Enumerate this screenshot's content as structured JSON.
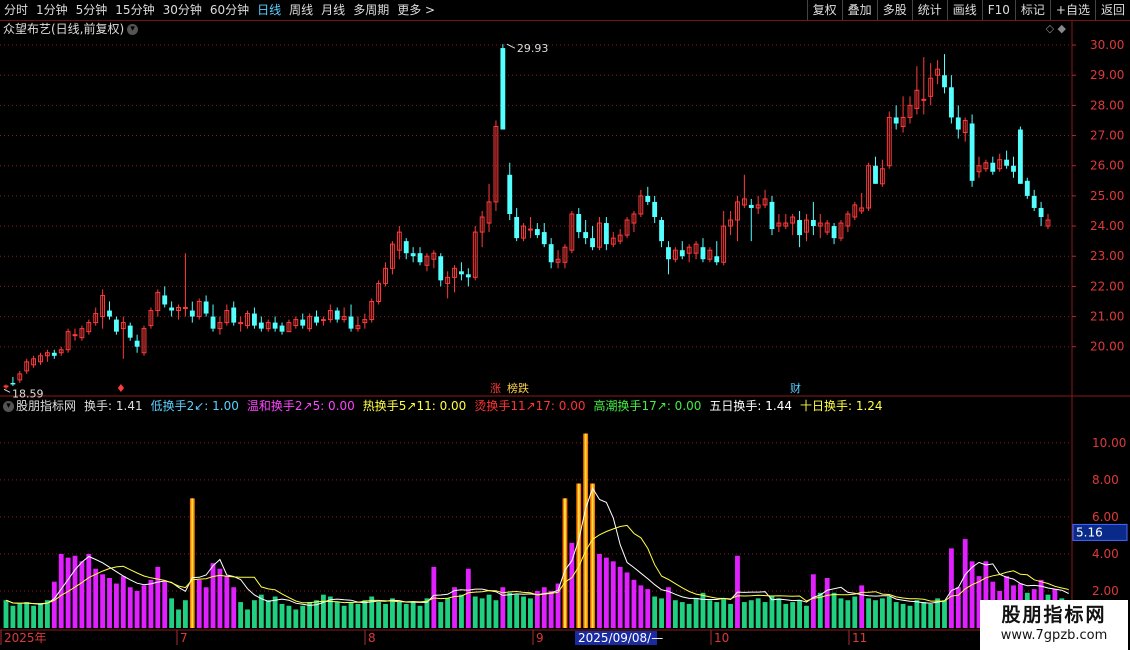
{
  "toolbar": {
    "periods": [
      "分时",
      "1分钟",
      "5分钟",
      "15分钟",
      "30分钟",
      "60分钟",
      "日线",
      "周线",
      "月线",
      "多周期",
      "更多 >"
    ],
    "active": "日线",
    "right_buttons": [
      "复权",
      "叠加",
      "多股",
      "统计",
      "画线",
      "F10",
      "标记",
      "+自选",
      "返回"
    ]
  },
  "price_panel": {
    "title": "众望布艺(日线,前复权)",
    "y_ticks": [
      "30.00",
      "29.00",
      "28.00",
      "27.00",
      "26.00",
      "25.00",
      "24.00",
      "23.00",
      "22.00",
      "21.00",
      "20.00"
    ],
    "high_label": "29.93",
    "low_label": "18.59",
    "markers": [
      "涨",
      "榜跌",
      "财"
    ],
    "top_icons": "◇ ◆"
  },
  "indicator_panel": {
    "name": "股朋指标网",
    "items": [
      {
        "label": "换手: 1.41",
        "color": "#dddddd"
      },
      {
        "label": "低换手2↙: 1.00",
        "color": "#5ad0ff"
      },
      {
        "label": "温和换手2↗5: 0.00",
        "color": "#ff44ff"
      },
      {
        "label": "热换手5↗11: 0.00",
        "color": "#ffff44"
      },
      {
        "label": "烫换手11↗17: 0.00",
        "color": "#ff3333"
      },
      {
        "label": "高潮换手17↗: 0.00",
        "color": "#44ee44"
      },
      {
        "label": "五日换手: 1.44",
        "color": "#ffffff"
      },
      {
        "label": "十日换手: 1.24",
        "color": "#ffff44"
      }
    ],
    "y_ticks": [
      "10.00",
      "8.00",
      "6.00",
      "4.00",
      "2.00"
    ],
    "current_value": "5.16"
  },
  "date_axis": {
    "labels": [
      "2025年",
      "7",
      "8",
      "9",
      "10",
      "11"
    ],
    "cursor_date": "2025/09/08/—"
  },
  "watermark": {
    "line1": "股朋指标网",
    "line2": "www.7gpzb.com"
  },
  "colors": {
    "up": "#ff3b3b",
    "down": "#54ffff",
    "grid": "#8b1a1a",
    "turnover_green": "#20d080",
    "turnover_magenta": "#e020ff",
    "turnover_gold": "#ffc000"
  },
  "chart_data": {
    "type": "candlestick",
    "ylim": [
      18.4,
      30.3
    ],
    "candles": [
      [
        18.7,
        18.75,
        18.59,
        18.7
      ],
      [
        18.8,
        19.0,
        18.7,
        18.75
      ],
      [
        18.9,
        19.2,
        18.8,
        19.1
      ],
      [
        19.2,
        19.6,
        19.1,
        19.5
      ],
      [
        19.4,
        19.7,
        19.3,
        19.6
      ],
      [
        19.5,
        19.8,
        19.4,
        19.7
      ],
      [
        19.7,
        19.9,
        19.5,
        19.8
      ],
      [
        19.8,
        19.9,
        19.6,
        19.7
      ],
      [
        19.8,
        20.0,
        19.7,
        19.9
      ],
      [
        19.9,
        20.6,
        19.8,
        20.5
      ],
      [
        20.4,
        20.6,
        20.2,
        20.4
      ],
      [
        20.3,
        20.7,
        20.2,
        20.6
      ],
      [
        20.5,
        20.9,
        20.4,
        20.8
      ],
      [
        20.8,
        21.3,
        20.7,
        21.1
      ],
      [
        21.0,
        21.9,
        20.6,
        21.7
      ],
      [
        21.2,
        21.5,
        20.9,
        21.0
      ],
      [
        20.9,
        21.0,
        20.4,
        20.5
      ],
      [
        20.6,
        21.0,
        19.6,
        20.8
      ],
      [
        20.7,
        20.8,
        20.2,
        20.3
      ],
      [
        20.2,
        20.4,
        19.8,
        20.0
      ],
      [
        19.8,
        20.7,
        19.7,
        20.6
      ],
      [
        20.7,
        21.3,
        20.6,
        21.2
      ],
      [
        21.2,
        21.9,
        21.0,
        21.8
      ],
      [
        21.7,
        22.0,
        21.3,
        21.4
      ],
      [
        21.3,
        21.5,
        21.0,
        21.2
      ],
      [
        21.2,
        21.4,
        20.9,
        21.3
      ],
      [
        21.3,
        23.1,
        21.0,
        21.3
      ],
      [
        21.2,
        21.5,
        20.8,
        21.0
      ],
      [
        21.0,
        21.6,
        20.9,
        21.5
      ],
      [
        21.5,
        21.7,
        21.0,
        21.1
      ],
      [
        21.0,
        21.4,
        20.5,
        20.6
      ],
      [
        20.6,
        21.0,
        20.4,
        20.8
      ],
      [
        20.8,
        21.4,
        20.7,
        21.2
      ],
      [
        21.3,
        21.5,
        20.7,
        20.8
      ],
      [
        20.8,
        21.0,
        20.5,
        20.8
      ],
      [
        20.7,
        21.2,
        20.6,
        21.1
      ],
      [
        21.1,
        21.3,
        20.6,
        20.7
      ],
      [
        20.8,
        21.0,
        20.5,
        20.6
      ],
      [
        20.6,
        20.9,
        20.5,
        20.8
      ],
      [
        20.8,
        21.0,
        20.5,
        20.6
      ],
      [
        20.7,
        20.8,
        20.4,
        20.5
      ],
      [
        20.5,
        20.9,
        20.5,
        20.8
      ],
      [
        20.7,
        21.0,
        20.6,
        20.9
      ],
      [
        20.9,
        21.1,
        20.6,
        20.7
      ],
      [
        20.6,
        21.1,
        20.5,
        21.0
      ],
      [
        21.0,
        21.2,
        20.7,
        20.8
      ],
      [
        20.9,
        21.0,
        20.7,
        20.9
      ],
      [
        20.9,
        21.4,
        20.8,
        21.2
      ],
      [
        21.2,
        21.3,
        20.8,
        20.9
      ],
      [
        20.9,
        21.3,
        20.8,
        21.0
      ],
      [
        21.0,
        21.4,
        20.5,
        20.6
      ],
      [
        20.6,
        21.0,
        20.5,
        20.7
      ],
      [
        20.8,
        21.1,
        20.6,
        20.9
      ],
      [
        20.9,
        21.6,
        20.8,
        21.5
      ],
      [
        21.5,
        22.2,
        21.4,
        22.1
      ],
      [
        22.1,
        22.8,
        22.0,
        22.6
      ],
      [
        22.6,
        23.5,
        22.4,
        23.4
      ],
      [
        23.2,
        24.0,
        22.9,
        23.8
      ],
      [
        23.5,
        23.6,
        22.9,
        23.1
      ],
      [
        23.1,
        23.3,
        22.8,
        23.0
      ],
      [
        23.1,
        23.3,
        22.7,
        22.8
      ],
      [
        22.7,
        23.1,
        22.5,
        23.0
      ],
      [
        22.9,
        23.2,
        22.6,
        23.1
      ],
      [
        23.0,
        23.1,
        22.0,
        22.2
      ],
      [
        22.1,
        22.5,
        21.6,
        22.3
      ],
      [
        22.3,
        22.7,
        21.8,
        22.6
      ],
      [
        22.5,
        22.8,
        22.2,
        22.4
      ],
      [
        22.4,
        22.6,
        22.0,
        22.3
      ],
      [
        22.3,
        24.0,
        22.2,
        23.8
      ],
      [
        23.8,
        24.5,
        23.3,
        24.3
      ],
      [
        24.1,
        25.4,
        23.8,
        24.8
      ],
      [
        24.8,
        27.5,
        24.5,
        27.3
      ],
      [
        29.9,
        30.03,
        27.3,
        27.2
      ],
      [
        25.7,
        26.1,
        24.2,
        24.4
      ],
      [
        24.3,
        24.6,
        23.5,
        23.6
      ],
      [
        23.6,
        24.1,
        23.5,
        24.0
      ],
      [
        23.9,
        24.3,
        23.6,
        23.9
      ],
      [
        23.9,
        24.1,
        23.6,
        23.7
      ],
      [
        23.8,
        24.1,
        23.3,
        23.4
      ],
      [
        23.4,
        23.6,
        22.6,
        22.8
      ],
      [
        22.8,
        23.2,
        22.6,
        22.9
      ],
      [
        22.8,
        23.4,
        22.6,
        23.3
      ],
      [
        23.2,
        24.5,
        23.1,
        24.4
      ],
      [
        24.4,
        24.6,
        23.6,
        23.8
      ],
      [
        23.8,
        24.2,
        23.4,
        23.6
      ],
      [
        23.6,
        24.0,
        23.2,
        23.3
      ],
      [
        23.3,
        24.3,
        23.2,
        24.1
      ],
      [
        24.1,
        24.3,
        23.2,
        23.4
      ],
      [
        23.4,
        23.8,
        23.3,
        23.6
      ],
      [
        23.5,
        23.9,
        23.4,
        23.7
      ],
      [
        23.7,
        24.3,
        23.6,
        24.2
      ],
      [
        24.1,
        24.5,
        23.8,
        24.4
      ],
      [
        24.4,
        25.2,
        24.3,
        25.0
      ],
      [
        25.0,
        25.3,
        24.7,
        24.8
      ],
      [
        24.8,
        25.0,
        24.1,
        24.3
      ],
      [
        24.2,
        24.3,
        23.3,
        23.5
      ],
      [
        23.3,
        23.5,
        22.4,
        22.9
      ],
      [
        22.9,
        23.3,
        22.8,
        23.2
      ],
      [
        23.2,
        23.5,
        22.9,
        23.0
      ],
      [
        23.1,
        23.4,
        22.8,
        23.3
      ],
      [
        23.1,
        23.5,
        22.9,
        23.4
      ],
      [
        23.3,
        23.6,
        22.8,
        22.9
      ],
      [
        22.9,
        23.3,
        22.8,
        23.2
      ],
      [
        23.0,
        23.5,
        22.7,
        22.8
      ],
      [
        22.8,
        24.5,
        22.7,
        24.0
      ],
      [
        24.0,
        24.5,
        23.7,
        24.2
      ],
      [
        24.2,
        25.0,
        23.5,
        24.8
      ],
      [
        24.7,
        25.7,
        24.6,
        24.9
      ],
      [
        24.7,
        24.9,
        23.5,
        24.6
      ],
      [
        24.6,
        25.0,
        24.4,
        24.7
      ],
      [
        24.7,
        25.2,
        24.6,
        24.9
      ],
      [
        24.8,
        25.0,
        23.7,
        23.9
      ],
      [
        24.0,
        24.4,
        23.8,
        24.1
      ],
      [
        24.0,
        24.4,
        23.9,
        24.1
      ],
      [
        24.1,
        24.4,
        23.7,
        24.3
      ],
      [
        24.2,
        24.5,
        23.3,
        23.7
      ],
      [
        23.8,
        24.4,
        23.5,
        24.2
      ],
      [
        24.2,
        24.8,
        23.7,
        24.0
      ],
      [
        24.0,
        24.4,
        23.6,
        24.1
      ],
      [
        23.8,
        24.2,
        23.7,
        24.1
      ],
      [
        24.0,
        24.1,
        23.4,
        23.6
      ],
      [
        23.6,
        24.2,
        23.5,
        24.1
      ],
      [
        24.0,
        24.5,
        23.8,
        24.4
      ],
      [
        24.3,
        24.8,
        24.2,
        24.7
      ],
      [
        24.5,
        25.1,
        24.4,
        24.6
      ],
      [
        24.6,
        26.1,
        24.5,
        26.0
      ],
      [
        26.0,
        26.3,
        25.4,
        25.4
      ],
      [
        25.4,
        26.2,
        25.3,
        25.9
      ],
      [
        26.0,
        27.8,
        25.9,
        27.6
      ],
      [
        27.6,
        28.0,
        27.2,
        27.4
      ],
      [
        27.3,
        28.3,
        27.1,
        27.6
      ],
      [
        27.6,
        28.3,
        27.4,
        28.0
      ],
      [
        27.9,
        29.3,
        27.7,
        28.5
      ],
      [
        28.2,
        29.6,
        27.7,
        28.2
      ],
      [
        28.3,
        29.4,
        28.0,
        28.9
      ],
      [
        29.0,
        29.5,
        28.7,
        29.2
      ],
      [
        29.0,
        29.7,
        28.4,
        28.6
      ],
      [
        28.6,
        29.0,
        27.4,
        27.6
      ],
      [
        27.6,
        28.0,
        26.9,
        27.2
      ],
      [
        27.1,
        27.6,
        26.8,
        27.5
      ],
      [
        27.4,
        27.7,
        25.3,
        25.5
      ],
      [
        25.8,
        26.3,
        25.6,
        26.0
      ],
      [
        25.9,
        26.2,
        25.8,
        26.1
      ],
      [
        26.1,
        26.3,
        25.7,
        25.8
      ],
      [
        25.9,
        26.4,
        25.8,
        26.2
      ],
      [
        26.2,
        26.5,
        25.9,
        26.0
      ],
      [
        26.0,
        26.3,
        25.6,
        25.8
      ],
      [
        27.2,
        27.3,
        25.4,
        25.4
      ],
      [
        25.5,
        25.6,
        24.9,
        25.0
      ],
      [
        25.0,
        25.2,
        24.5,
        24.6
      ],
      [
        24.6,
        24.8,
        24.0,
        24.3
      ],
      [
        24.0,
        24.4,
        23.9,
        24.2
      ]
    ],
    "turnover_ylim": [
      0,
      11.5
    ],
    "turnover": [
      1.5,
      1.2,
      1.3,
      1.4,
      1.2,
      1.3,
      1.5,
      2.5,
      4.0,
      3.8,
      3.9,
      3.6,
      4.0,
      3.2,
      2.9,
      2.7,
      2.4,
      2.8,
      2.2,
      2.0,
      2.3,
      2.6,
      3.3,
      2.5,
      1.6,
      1.0,
      1.5,
      7.0,
      2.6,
      2.2,
      3.5,
      3.2,
      2.8,
      2.2,
      1.4,
      1.0,
      1.5,
      1.8,
      1.5,
      1.7,
      1.3,
      1.2,
      1.0,
      1.2,
      1.4,
      1.5,
      1.8,
      1.7,
      1.4,
      1.2,
      1.4,
      1.3,
      1.5,
      1.7,
      1.4,
      1.3,
      1.6,
      1.4,
      1.3,
      1.4,
      1.2,
      1.6,
      3.3,
      1.4,
      1.6,
      2.2,
      1.8,
      3.2,
      1.7,
      1.6,
      1.8,
      1.5,
      2.2,
      1.9,
      1.8,
      1.7,
      1.6,
      2.0,
      2.2,
      2.0,
      2.4,
      7.0,
      4.6,
      7.8,
      10.5,
      7.8,
      4.0,
      3.8,
      3.6,
      3.3,
      3.0,
      2.6,
      2.3,
      2.1,
      1.7,
      1.6,
      2.2,
      1.5,
      1.4,
      1.3,
      1.6,
      1.9,
      1.5,
      1.4,
      1.6,
      1.3,
      3.9,
      1.4,
      1.5,
      1.6,
      1.4,
      1.7,
      1.6,
      1.3,
      1.4,
      1.5,
      1.2,
      2.9,
      1.9,
      2.7,
      1.9,
      1.6,
      1.5,
      1.7,
      2.3,
      1.6,
      1.5,
      1.6,
      1.7,
      1.4,
      1.3,
      1.2,
      1.5,
      1.4,
      1.3,
      1.6,
      1.5,
      4.3,
      2.2,
      4.8,
      3.6,
      2.8,
      3.6,
      2.5,
      2.0,
      2.8,
      2.3,
      2.4,
      1.9,
      2.1,
      2.6,
      1.8,
      2.1,
      1.6,
      1.2
    ]
  }
}
